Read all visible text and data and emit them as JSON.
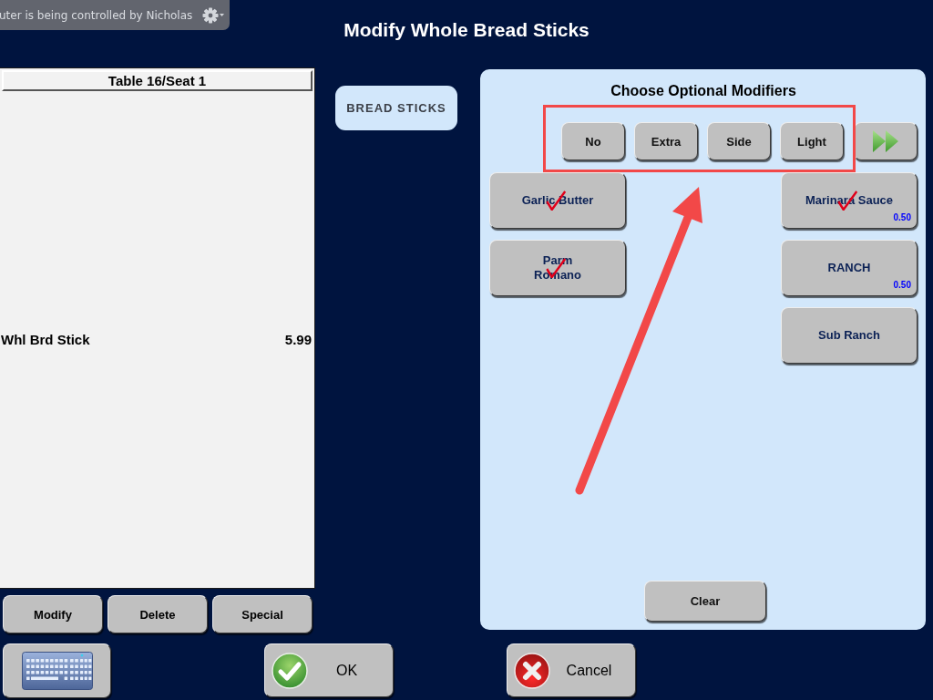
{
  "remote_banner": {
    "text": "uter is being controlled by Nicholas"
  },
  "title": "Modify Whole Bread Sticks",
  "order": {
    "header": "Table 16/Seat 1",
    "items": [
      {
        "name": "Whl Brd Stick",
        "price": "5.99"
      }
    ]
  },
  "order_actions": [
    {
      "label": "Modify"
    },
    {
      "label": "Delete"
    },
    {
      "label": "Special"
    }
  ],
  "categories": [
    {
      "label": "BREAD STICKS",
      "selected": true
    }
  ],
  "modifiers_panel": {
    "title": "Choose Optional Modifiers",
    "prefixes": [
      {
        "label": "No",
        "selected": false
      },
      {
        "label": "Extra",
        "selected": false
      },
      {
        "label": "Side",
        "selected": false
      },
      {
        "label": "Light",
        "selected": false
      }
    ],
    "left_column": [
      {
        "label": "Garlic Butter",
        "checked": true
      },
      {
        "label": "Parm\nRomano",
        "checked": true
      }
    ],
    "right_column": [
      {
        "label": "Marinara Sauce",
        "checked": true,
        "price": "0.50"
      },
      {
        "label": "RANCH",
        "checked": false,
        "price": "0.50"
      },
      {
        "label": "Sub Ranch",
        "checked": false
      }
    ],
    "clear": "Clear"
  },
  "footer": {
    "buttons": [
      {
        "kind": "ok",
        "label": "OK"
      },
      {
        "kind": "cancel",
        "label": "Cancel"
      }
    ]
  }
}
